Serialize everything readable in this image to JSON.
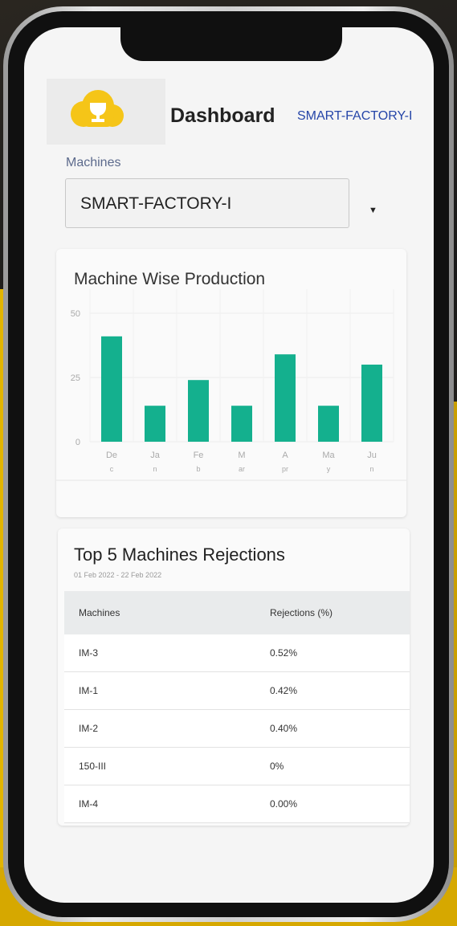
{
  "header": {
    "title": "Dashboard",
    "factory_link": "SMART-FACTORY-I"
  },
  "machines_select": {
    "label": "Machines",
    "value": "SMART-FACTORY-I"
  },
  "colors": {
    "bar": "#14b08e",
    "accent_link": "#2545a8",
    "logo": "#f5c518"
  },
  "chart_data": {
    "type": "bar",
    "title": "Machine Wise Production",
    "categories": [
      "Dec",
      "Jan",
      "Feb",
      "Mar",
      "Apr",
      "May",
      "Jun"
    ],
    "tick_labels": [
      [
        "De",
        "c"
      ],
      [
        "Ja",
        "n"
      ],
      [
        "Fe",
        "b"
      ],
      [
        "M",
        "ar"
      ],
      [
        "A",
        "pr"
      ],
      [
        "Ma",
        "y"
      ],
      [
        "Ju",
        "n"
      ]
    ],
    "values": [
      41,
      14,
      24,
      14,
      34,
      14,
      30
    ],
    "ylim": [
      0,
      50
    ],
    "yticks": [
      0,
      25,
      50
    ],
    "xlabel": "",
    "ylabel": "",
    "grid": true
  },
  "rejections": {
    "title": "Top 5 Machines Rejections",
    "date_range": "01 Feb 2022 - 22 Feb 2022",
    "columns": [
      "Machines",
      "Rejections (%)"
    ],
    "rows": [
      [
        "IM-3",
        "0.52%"
      ],
      [
        "IM-1",
        "0.42%"
      ],
      [
        "IM-2",
        "0.40%"
      ],
      [
        "150-III",
        "0%"
      ],
      [
        "IM-4",
        "0.00%"
      ]
    ]
  }
}
